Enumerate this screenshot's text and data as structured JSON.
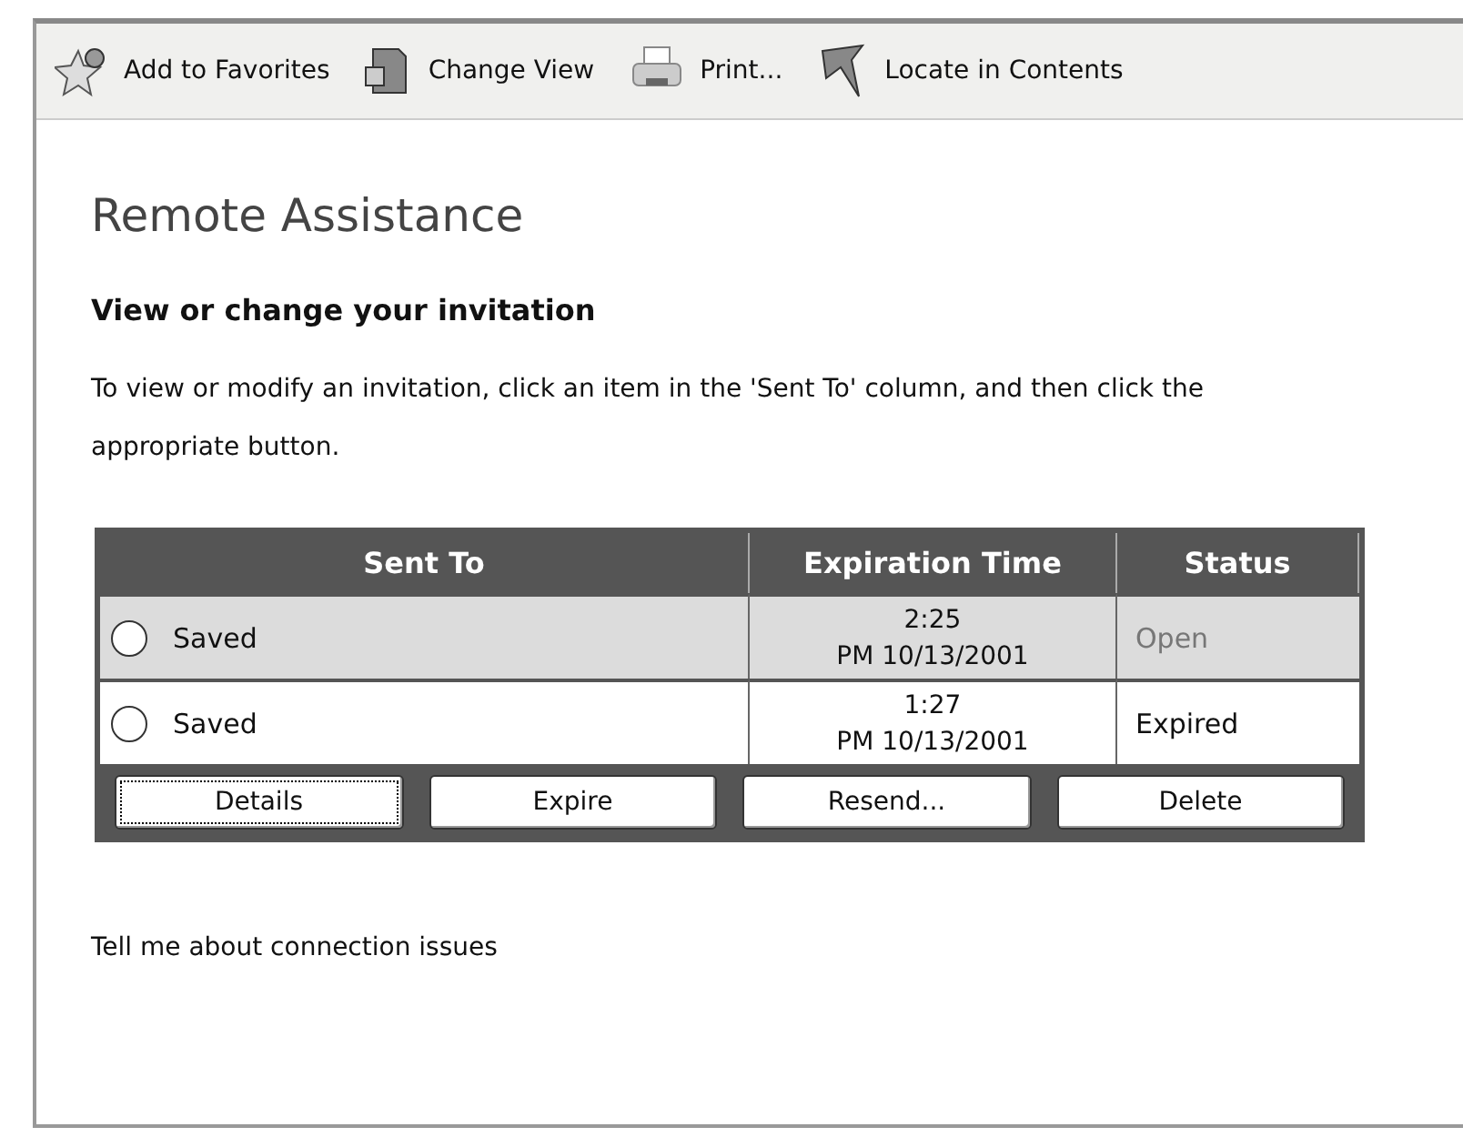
{
  "toolbar": [
    {
      "label": "Add to Favorites",
      "kind": "star"
    },
    {
      "label": "Change View",
      "kind": "view"
    },
    {
      "label": "Print...",
      "kind": "print"
    },
    {
      "label": "Locate in Contents",
      "kind": "locate"
    }
  ],
  "title": "Remote Assistance",
  "heading": "View or change your invitation",
  "instructions": "To view or modify an invitation, click an item in the 'Sent To' column, and then click the appropriate button.",
  "table": {
    "columns": [
      "Sent To",
      "Expiration Time",
      "Status"
    ],
    "rows": [
      {
        "sent_to": "Saved",
        "time": "2:25",
        "date": "PM  10/13/2001",
        "status": "Open",
        "selected": false,
        "highlighted": true,
        "status_dim": true
      },
      {
        "sent_to": "Saved",
        "time": "1:27",
        "date": "PM  10/13/2001",
        "status": "Expired",
        "selected": false,
        "highlighted": false,
        "status_dim": false
      }
    ],
    "buttons": [
      {
        "label": "Details",
        "focused": true
      },
      {
        "label": "Expire",
        "focused": false
      },
      {
        "label": "Resend...",
        "focused": false
      },
      {
        "label": "Delete",
        "focused": false
      }
    ]
  },
  "link": "Tell me about connection issues"
}
